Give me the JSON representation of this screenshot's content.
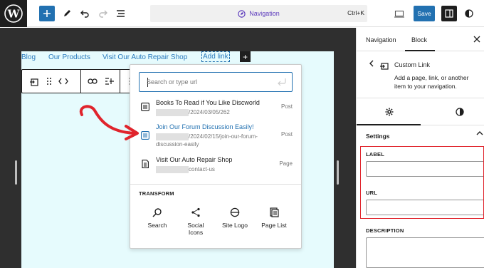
{
  "topbar": {
    "nav_label": "Navigation",
    "shortcut": "Ctrl+K",
    "save_label": "Save"
  },
  "nav_menu": {
    "items": [
      "Blog",
      "Our Products",
      "Visit Our Auto Repair Shop"
    ],
    "add_link_label": "Add link"
  },
  "link_popover": {
    "search_placeholder": "Search or type url",
    "suggestions": [
      {
        "title": "Books To Read if You Like Discworld",
        "url": "/2024/03/05/262",
        "type": "Post"
      },
      {
        "title": "Join Our Forum Discussion Easily!",
        "url": "/2024/02/15/join-our-forum-",
        "url2": "discussion-easily",
        "type": "Post"
      },
      {
        "title": "Visit Our Auto Repair Shop",
        "url": "contact-us",
        "type": "Page"
      }
    ],
    "transform_label": "TRANSFORM",
    "transforms": [
      {
        "label": "Search",
        "icon": "search-icon"
      },
      {
        "label": "Social",
        "label2": "Icons",
        "icon": "share-icon"
      },
      {
        "label": "Site Logo",
        "icon": "site-logo-icon"
      },
      {
        "label": "Page List",
        "icon": "page-list-icon"
      }
    ]
  },
  "sidebar": {
    "tabs": [
      "Navigation",
      "Block"
    ],
    "block_title": "Custom Link",
    "block_description": "Add a page, link, or another item to your navigation.",
    "settings_label": "Settings",
    "label_field": "LABEL",
    "url_field": "URL",
    "description_field": "DESCRIPTION"
  },
  "colors": {
    "accent": "#2271b1",
    "nav_purple": "#5d3cbd",
    "highlight_red": "#e0242c",
    "canvas_bg": "#2f2f2f",
    "frame_bg": "#e6fbfd"
  }
}
